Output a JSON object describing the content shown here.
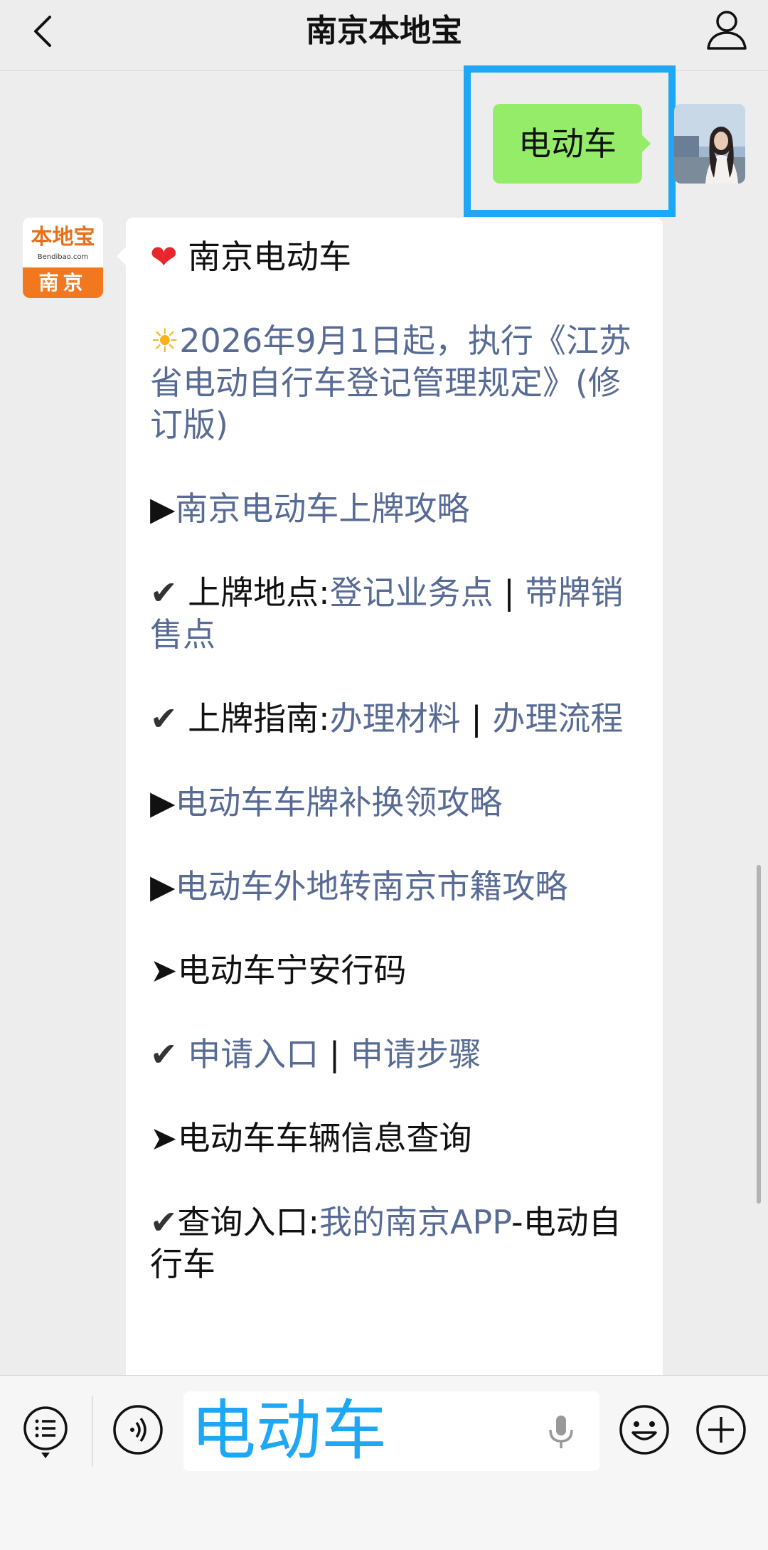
{
  "header": {
    "title": "南京本地宝"
  },
  "outgoing": {
    "text": "电动车"
  },
  "bot": {
    "logo_text": "本地宝",
    "logo_sub": "Bendibao.com",
    "logo_city": "南京"
  },
  "message": {
    "heading": "南京电动车",
    "notice": "2026年9月1日起，执行《江苏省电动自行车登记管理规定》(修订版)",
    "link_plate_guide": "南京电动车上牌攻略",
    "plate_location_label": "上牌地点:",
    "link_register_points": "登记业务点",
    "link_plate_sale_points": "带牌销售点",
    "plate_guide_label": "上牌指南:",
    "link_materials": "办理材料",
    "link_process": "办理流程",
    "link_replace": "电动车车牌补换领攻略",
    "link_transfer": "电动车外地转南京市籍攻略",
    "code_heading": "电动车宁安行码",
    "link_apply_entry": "申请入口",
    "link_apply_steps": "申请步骤",
    "vehicle_info_heading": "电动车车辆信息查询",
    "query_label": "查询入口:",
    "link_app": "我的南京APP",
    "query_suffix": "-电动自行车",
    "separator": "|"
  },
  "input": {
    "value": "电动车"
  },
  "colors": {
    "outgoing_bubble": "#95ec69",
    "highlight": "#1ea7f5",
    "link": "#576b95",
    "brand_orange": "#f2781f"
  }
}
